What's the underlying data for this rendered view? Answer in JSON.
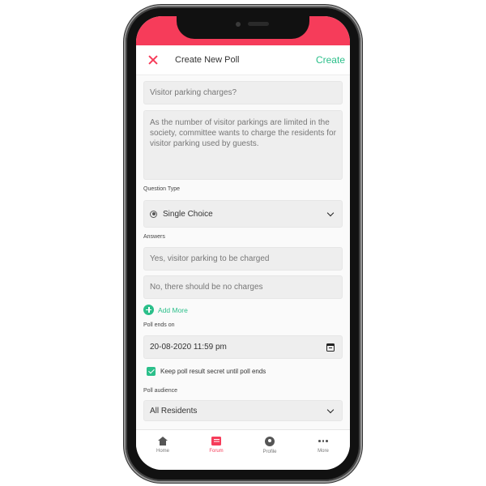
{
  "header": {
    "title": "Create New Poll",
    "create_label": "Create"
  },
  "form": {
    "question_value": "Visitor parking charges?",
    "description_value": "As the number of visitor parkings are limited in the society, committee wants to charge the residents for visitor parking used by guests.",
    "question_type_label": "Question Type",
    "question_type_value": "Single Choice",
    "answers_label": "Answers",
    "answers": [
      "Yes, visitor parking to be charged",
      "No, there should be no charges"
    ],
    "add_more_label": "Add More",
    "poll_ends_label": "Poll ends on",
    "poll_ends_value": "20-08-2020 11:59 pm",
    "secret_label": "Keep poll result secret until poll ends",
    "secret_checked": true,
    "audience_label": "Poll audience",
    "audience_value": "All Residents"
  },
  "tabbar": {
    "items": [
      {
        "label": "Home",
        "icon": "home-icon",
        "active": false
      },
      {
        "label": "Forum",
        "icon": "forum-icon",
        "active": true
      },
      {
        "label": "Profile",
        "icon": "profile-icon",
        "active": false
      },
      {
        "label": "More",
        "icon": "more-icon",
        "active": false
      }
    ]
  },
  "colors": {
    "brand": "#f63c5a",
    "accent": "#2bbf8a"
  }
}
